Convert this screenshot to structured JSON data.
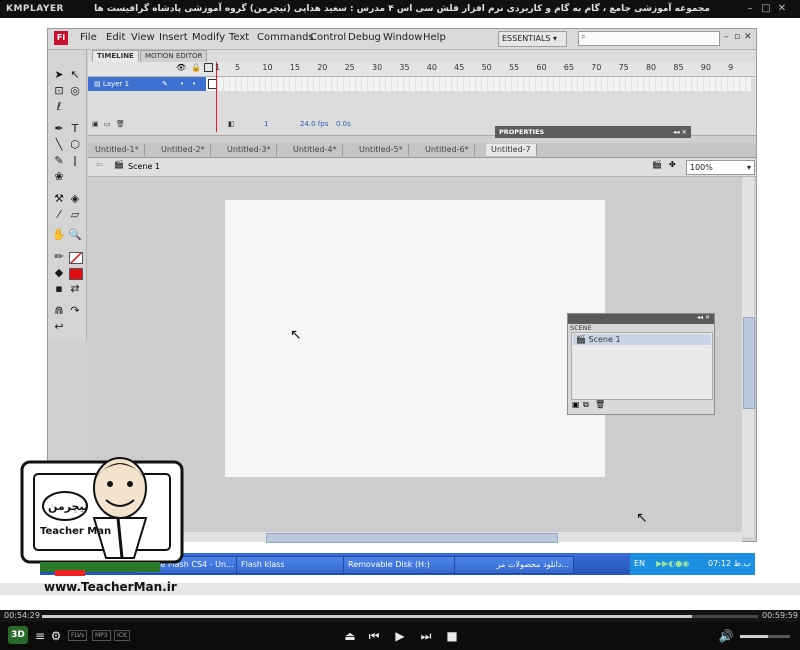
{
  "player": {
    "logo": "KMPLAYER",
    "caption": "مجموعه آموزشی جامع ، گام به گام و کاربردی نرم افزار فلش سی اس ۴ مدرس : سعید هدایی (تیچرمن) گروه آموزشی پادشاه گرافیست ها",
    "elapsed": "00:54:29",
    "total": "00:59:59",
    "progress": 0.908,
    "volume": 0.55,
    "badges": [
      "FLVs",
      "MP3",
      "ICK"
    ]
  },
  "flash": {
    "logo": "Fl",
    "menu": [
      "File",
      "Edit",
      "View",
      "Insert",
      "Modify",
      "Text",
      "Commands",
      "Control",
      "Debug",
      "Window",
      "Help"
    ],
    "workspace": "ESSENTIALS",
    "timeline_tabs": [
      "TIMELINE",
      "MOTION EDITOR"
    ],
    "frame_numbers": [
      "1",
      "5",
      "10",
      "15",
      "20",
      "25",
      "30",
      "35",
      "40",
      "45",
      "50",
      "55",
      "60",
      "65",
      "70",
      "75",
      "80",
      "85",
      "90",
      "9"
    ],
    "layer_name": "Layer 1",
    "timeline_status": {
      "frame": "1",
      "fps": "24.0 fps",
      "time": "0.0s"
    },
    "properties_label": "PROPERTIES",
    "doc_tabs": [
      "Untitled-1*",
      "Untitled-2*",
      "Untitled-3*",
      "Untitled-4*",
      "Untitled-5*",
      "Untitled-6*",
      "Untitled-7"
    ],
    "active_doc": 6,
    "scene_label": "Scene 1",
    "zoom": "100%",
    "scene_panel_title": "SCENE",
    "scene_panel_item": "Scene 1"
  },
  "taskbar": {
    "items": [
      "Adobe Flash CS4 - Un...",
      "Flash klass",
      "Removable Disk (H:)",
      "...دانلود محصولات مر"
    ],
    "language": "EN",
    "clock": "07:12 ب.ظ"
  },
  "mascot": {
    "brand_fa": "تیچرمن",
    "brand_en": "Teacher Man",
    "website": "www.TeacherMan.ir"
  },
  "colors": {
    "flash_red": "#c8102e",
    "selection_blue": "#3d6fd1",
    "taskbar_blue": "#2453b7"
  }
}
